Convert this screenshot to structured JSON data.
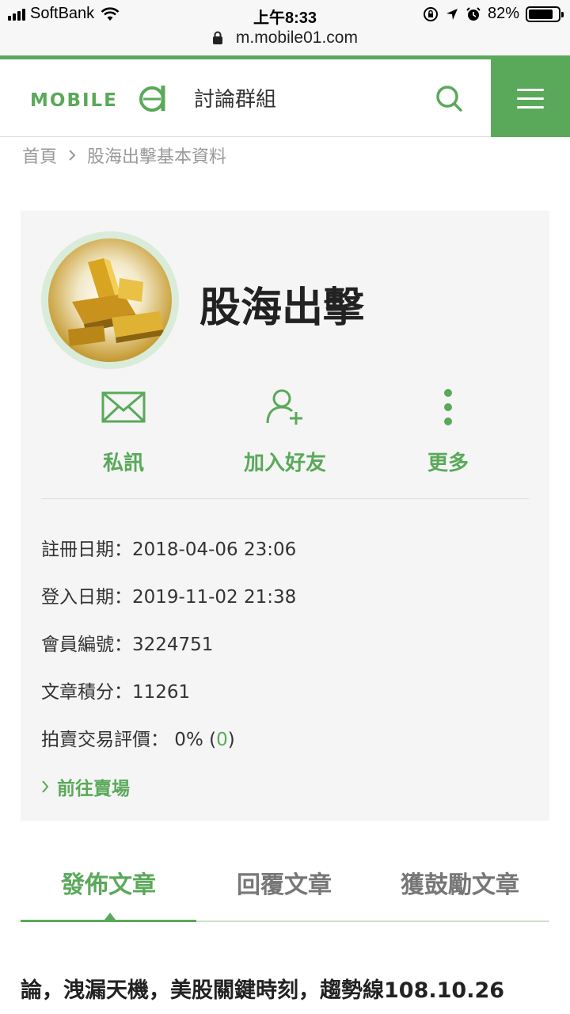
{
  "status_bar": {
    "carrier": "SoftBank",
    "time": "上午8:33",
    "battery_percent": "82%",
    "battery_level": 0.82
  },
  "browser": {
    "url": "m.mobile01.com"
  },
  "header": {
    "section_title": "討論群組",
    "logo_alt": "MOBILE01"
  },
  "breadcrumb": {
    "home": "首頁",
    "current": "股海出擊基本資料"
  },
  "profile": {
    "username": "股海出擊",
    "actions": {
      "message": "私訊",
      "add_friend": "加入好友",
      "more": "更多"
    },
    "info": {
      "register": "註冊日期：2018-04-06 23:06",
      "login": "登入日期：2019-11-02 21:38",
      "member_id": "會員編號：3224751",
      "points": "文章積分：11261",
      "rating_label": "拍賣交易評價： 0% (",
      "rating_count": "0",
      "rating_close": ")"
    },
    "goto_shop": "前往賣場"
  },
  "tabs": {
    "posts": "發佈文章",
    "replies": "回覆文章",
    "encouraged": "獲鼓勵文章"
  },
  "post": {
    "title": "論，洩漏天機，美股關鍵時刻，趨勢線108.10.26"
  },
  "colors": {
    "accent": "#5aa95a"
  }
}
